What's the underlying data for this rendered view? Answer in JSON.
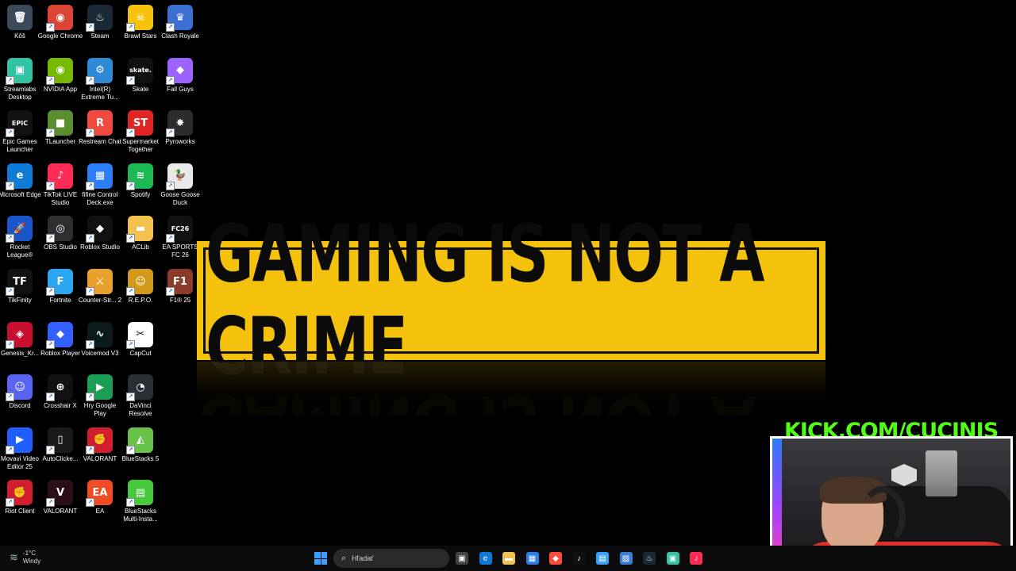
{
  "desktop": {
    "icons": [
      {
        "label": "Kôš",
        "glyph": "🗑",
        "color": "#3a4a5a"
      },
      {
        "label": "Google Chrome",
        "glyph": "◉",
        "color": "#db4437"
      },
      {
        "label": "Steam",
        "glyph": "♨",
        "color": "#1b2838"
      },
      {
        "label": "Brawl Stars",
        "glyph": "☠",
        "color": "#f7c20b"
      },
      {
        "label": "Clash Royale",
        "glyph": "♛",
        "color": "#3b6fd1"
      },
      {
        "label": "Streamlabs Desktop",
        "glyph": "▣",
        "color": "#31c3a2"
      },
      {
        "label": "NVIDIA App",
        "glyph": "◉",
        "color": "#76b900"
      },
      {
        "label": "Intel(R) Extreme Tu...",
        "glyph": "⚙",
        "color": "#2e89d6"
      },
      {
        "label": "Skate",
        "glyph": "skate.",
        "color": "#111"
      },
      {
        "label": "Fall Guys",
        "glyph": "◆",
        "color": "#9b63ff"
      },
      {
        "label": "Epic Games Launcher",
        "glyph": "EPIC",
        "color": "#111"
      },
      {
        "label": "TLauncher",
        "glyph": "■",
        "color": "#5a8f2f"
      },
      {
        "label": "Restream Chat",
        "glyph": "R",
        "color": "#f04a3e"
      },
      {
        "label": "Supermarket Together",
        "glyph": "ST",
        "color": "#e02323"
      },
      {
        "label": "Pyroworks",
        "glyph": "✸",
        "color": "#2c2c2c"
      },
      {
        "label": "Microsoft Edge",
        "glyph": "e",
        "color": "#0f7bd6"
      },
      {
        "label": "TikTok LIVE Studio",
        "glyph": "♪",
        "color": "#fe2c55"
      },
      {
        "label": "fifine Control Deck.exe",
        "glyph": "▦",
        "color": "#2c7ef8"
      },
      {
        "label": "Spotify",
        "glyph": "≋",
        "color": "#1db954"
      },
      {
        "label": "Goose Goose Duck",
        "glyph": "🦆",
        "color": "#e9e9e9"
      },
      {
        "label": "Rocket League®",
        "glyph": "🚀",
        "color": "#1a56c9"
      },
      {
        "label": "OBS Studio",
        "glyph": "◎",
        "color": "#302e31"
      },
      {
        "label": "Roblox Studio",
        "glyph": "◆",
        "color": "#111"
      },
      {
        "label": "ACLib",
        "glyph": "▬",
        "color": "#f2c14e"
      },
      {
        "label": "EA SPORTS FC 26",
        "glyph": "FC26",
        "color": "#111"
      },
      {
        "label": "TikFinity",
        "glyph": "TF",
        "color": "#111"
      },
      {
        "label": "Fortnite",
        "glyph": "F",
        "color": "#2aa7f0"
      },
      {
        "label": "Counter-Str... 2",
        "glyph": "⚔",
        "color": "#e8a12a"
      },
      {
        "label": "R.E.P.O.",
        "glyph": "☺",
        "color": "#d39a19"
      },
      {
        "label": "F1® 25",
        "glyph": "F1",
        "color": "#8b3a2b"
      },
      {
        "label": "Genesis_Kr...",
        "glyph": "◈",
        "color": "#c8102e"
      },
      {
        "label": "Roblox Player",
        "glyph": "◆",
        "color": "#335fff"
      },
      {
        "label": "Voicemod V3",
        "glyph": "∿",
        "color": "#0b1a1a"
      },
      {
        "label": "CapCut",
        "glyph": "✂",
        "color": "#ffffff"
      },
      {
        "label": "",
        "glyph": "",
        "color": "transparent"
      },
      {
        "label": "Discord",
        "glyph": "☺",
        "color": "#5865f2"
      },
      {
        "label": "Crosshair X",
        "glyph": "⊕",
        "color": "#111"
      },
      {
        "label": "Hry Google Play",
        "glyph": "▶",
        "color": "#1a9e55"
      },
      {
        "label": "DaVinci Resolve",
        "glyph": "◔",
        "color": "#2a2f36"
      },
      {
        "label": "",
        "glyph": "",
        "color": "transparent"
      },
      {
        "label": "Movavi Video Editor 25",
        "glyph": "▶",
        "color": "#1f5eff"
      },
      {
        "label": "AutoClicke...",
        "glyph": "▯",
        "color": "#1a1a1a"
      },
      {
        "label": "VALORANT",
        "glyph": "✊",
        "color": "#d11e2f"
      },
      {
        "label": "BlueStacks 5",
        "glyph": "◭",
        "color": "#69c34a"
      },
      {
        "label": "",
        "glyph": "",
        "color": "transparent"
      },
      {
        "label": "Riot Client",
        "glyph": "✊",
        "color": "#d11e2f"
      },
      {
        "label": "VALORANT",
        "glyph": "V",
        "color": "#2b0f17"
      },
      {
        "label": "EA",
        "glyph": "EA",
        "color": "#f04b23"
      },
      {
        "label": "BlueStacks Multi-Insta...",
        "glyph": "▤",
        "color": "#46c93a"
      },
      {
        "label": "",
        "glyph": "",
        "color": "transparent"
      }
    ]
  },
  "wallpaper": {
    "banner_text": "GAMING IS NOT A CRIME"
  },
  "overlay": {
    "kick_text": "KICK.COM/CUCINIS"
  },
  "taskbar": {
    "weather_temp": "-1°C",
    "weather_text": "Windy",
    "search_placeholder": "Hľadať",
    "apps": [
      {
        "name": "task-view-icon",
        "glyph": "▣",
        "color": "#444"
      },
      {
        "name": "edge-taskbar-icon",
        "glyph": "e",
        "color": "#0f7bd6"
      },
      {
        "name": "file-explorer-icon",
        "glyph": "▬",
        "color": "#f2c14e"
      },
      {
        "name": "store-icon",
        "glyph": "▦",
        "color": "#2b7de9"
      },
      {
        "name": "app-diamond-icon",
        "glyph": "◆",
        "color": "#ff4a3d"
      },
      {
        "name": "tiktok-taskbar-icon",
        "glyph": "♪",
        "color": "#111"
      },
      {
        "name": "notepad-icon",
        "glyph": "▤",
        "color": "#3aa0ff"
      },
      {
        "name": "photos-icon",
        "glyph": "▨",
        "color": "#3a7bd5"
      },
      {
        "name": "steam-taskbar-icon",
        "glyph": "♨",
        "color": "#1b2838"
      },
      {
        "name": "streamlabs-taskbar-icon",
        "glyph": "▣",
        "color": "#31c3a2"
      },
      {
        "name": "tiktok-live-taskbar-icon",
        "glyph": "♪",
        "color": "#fe2c55"
      }
    ]
  }
}
